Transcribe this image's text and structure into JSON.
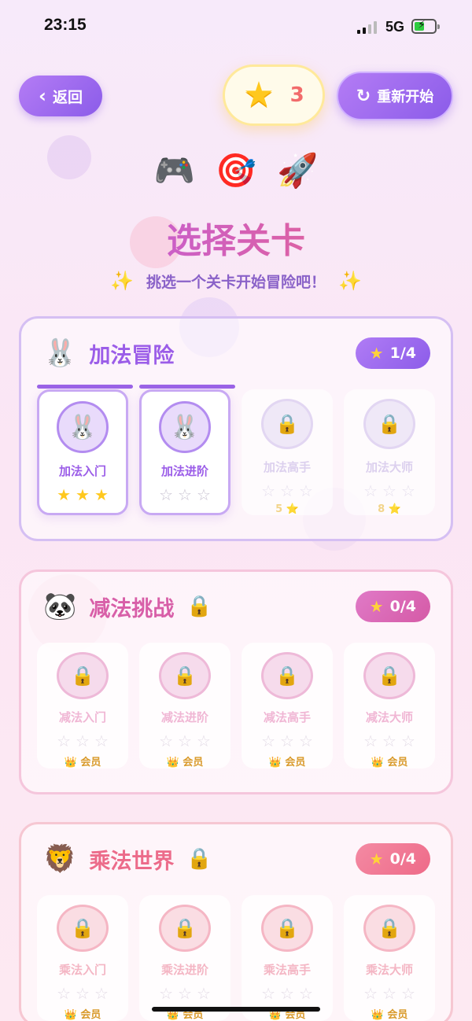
{
  "status_bar": {
    "time": "23:15",
    "network": "5G"
  },
  "header": {
    "back_label": "返回",
    "stars_count": "3",
    "restart_label": "重新开始"
  },
  "hero": {
    "emojis": [
      "🎮",
      "🎯",
      "🚀"
    ],
    "title": "选择关卡",
    "subtitle": "挑选一个关卡开始冒险吧！",
    "sparkle": "✨"
  },
  "sections": [
    {
      "emoji": "🐰",
      "name": "加法冒险",
      "locked": false,
      "progress": "1/4",
      "levels": [
        {
          "name": "加法入门",
          "state": "done",
          "icon": "🐰",
          "stars": [
            "★",
            "★",
            "★"
          ]
        },
        {
          "name": "加法进阶",
          "state": "open",
          "icon": "🐰",
          "stars": [
            "☆",
            "☆",
            "☆"
          ]
        },
        {
          "name": "加法高手",
          "state": "locked",
          "icon": "🔒",
          "stars": [
            "☆",
            "☆",
            "☆"
          ],
          "requirement": "5 ⭐"
        },
        {
          "name": "加法大师",
          "state": "locked",
          "icon": "🔒",
          "stars": [
            "☆",
            "☆",
            "☆"
          ],
          "requirement": "8 ⭐"
        }
      ]
    },
    {
      "emoji": "🐼",
      "name": "减法挑战",
      "locked": true,
      "lock_icon": "🔒",
      "progress": "0/4",
      "levels": [
        {
          "name": "减法入门",
          "icon": "🔒",
          "stars": [
            "☆",
            "☆",
            "☆"
          ],
          "requirement": "👑 会员"
        },
        {
          "name": "减法进阶",
          "icon": "🔒",
          "stars": [
            "☆",
            "☆",
            "☆"
          ],
          "requirement": "👑 会员"
        },
        {
          "name": "减法高手",
          "icon": "🔒",
          "stars": [
            "☆",
            "☆",
            "☆"
          ],
          "requirement": "👑 会员"
        },
        {
          "name": "减法大师",
          "icon": "🔒",
          "stars": [
            "☆",
            "☆",
            "☆"
          ],
          "requirement": "👑 会员"
        }
      ]
    },
    {
      "emoji": "🦁",
      "name": "乘法世界",
      "locked": true,
      "lock_icon": "🔒",
      "progress": "0/4",
      "levels": [
        {
          "name": "乘法入门",
          "icon": "🔒",
          "stars": [
            "☆",
            "☆",
            "☆"
          ],
          "requirement": "👑 会员"
        },
        {
          "name": "乘法进阶",
          "icon": "🔒",
          "stars": [
            "☆",
            "☆",
            "☆"
          ],
          "requirement": "👑 会员"
        },
        {
          "name": "乘法高手",
          "icon": "🔒",
          "stars": [
            "☆",
            "☆",
            "☆"
          ],
          "requirement": "👑 会员"
        },
        {
          "name": "乘法大师",
          "icon": "🔒",
          "stars": [
            "☆",
            "☆",
            "☆"
          ],
          "requirement": "👑 会员"
        }
      ]
    }
  ],
  "colors": {
    "accent": "#8b5ce9",
    "star": "#ffc81e",
    "title_gradient": [
      "#b75df0",
      "#f0637c"
    ]
  }
}
